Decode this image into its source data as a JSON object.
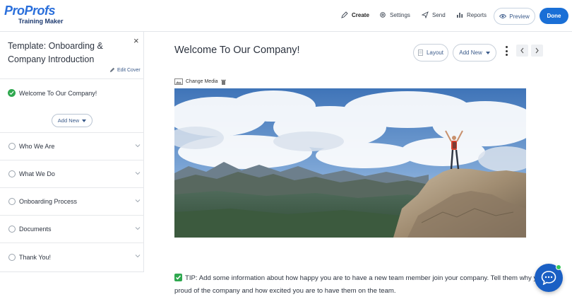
{
  "brand": {
    "logo_text": "ProProfs",
    "logo_sub": "Training Maker"
  },
  "nav": {
    "create": "Create",
    "settings": "Settings",
    "send": "Send",
    "reports": "Reports",
    "preview": "Preview",
    "done": "Done"
  },
  "sidebar": {
    "title": "Template: Onboarding & Company Introduction",
    "edit_cover": "Edit Cover",
    "first_item": "Welcome To Our Company!",
    "add_new": "Add New",
    "items": [
      {
        "label": "Who We Are"
      },
      {
        "label": "What We Do"
      },
      {
        "label": "Onboarding Process"
      },
      {
        "label": "Documents"
      },
      {
        "label": "Thank You!"
      }
    ]
  },
  "main": {
    "title": "Welcome To Our Company!",
    "layout_button": "Layout",
    "add_new_button": "Add New",
    "change_media": "Change Media",
    "tip_text": "TIP: Add some information about how happy you are to have a new team member join your company. Tell them why you're proud of the company and how excited you are to have them on the team."
  },
  "colors": {
    "accent": "#1a6fd6",
    "success": "#2fa84f",
    "chat": "#1a5fc4"
  }
}
